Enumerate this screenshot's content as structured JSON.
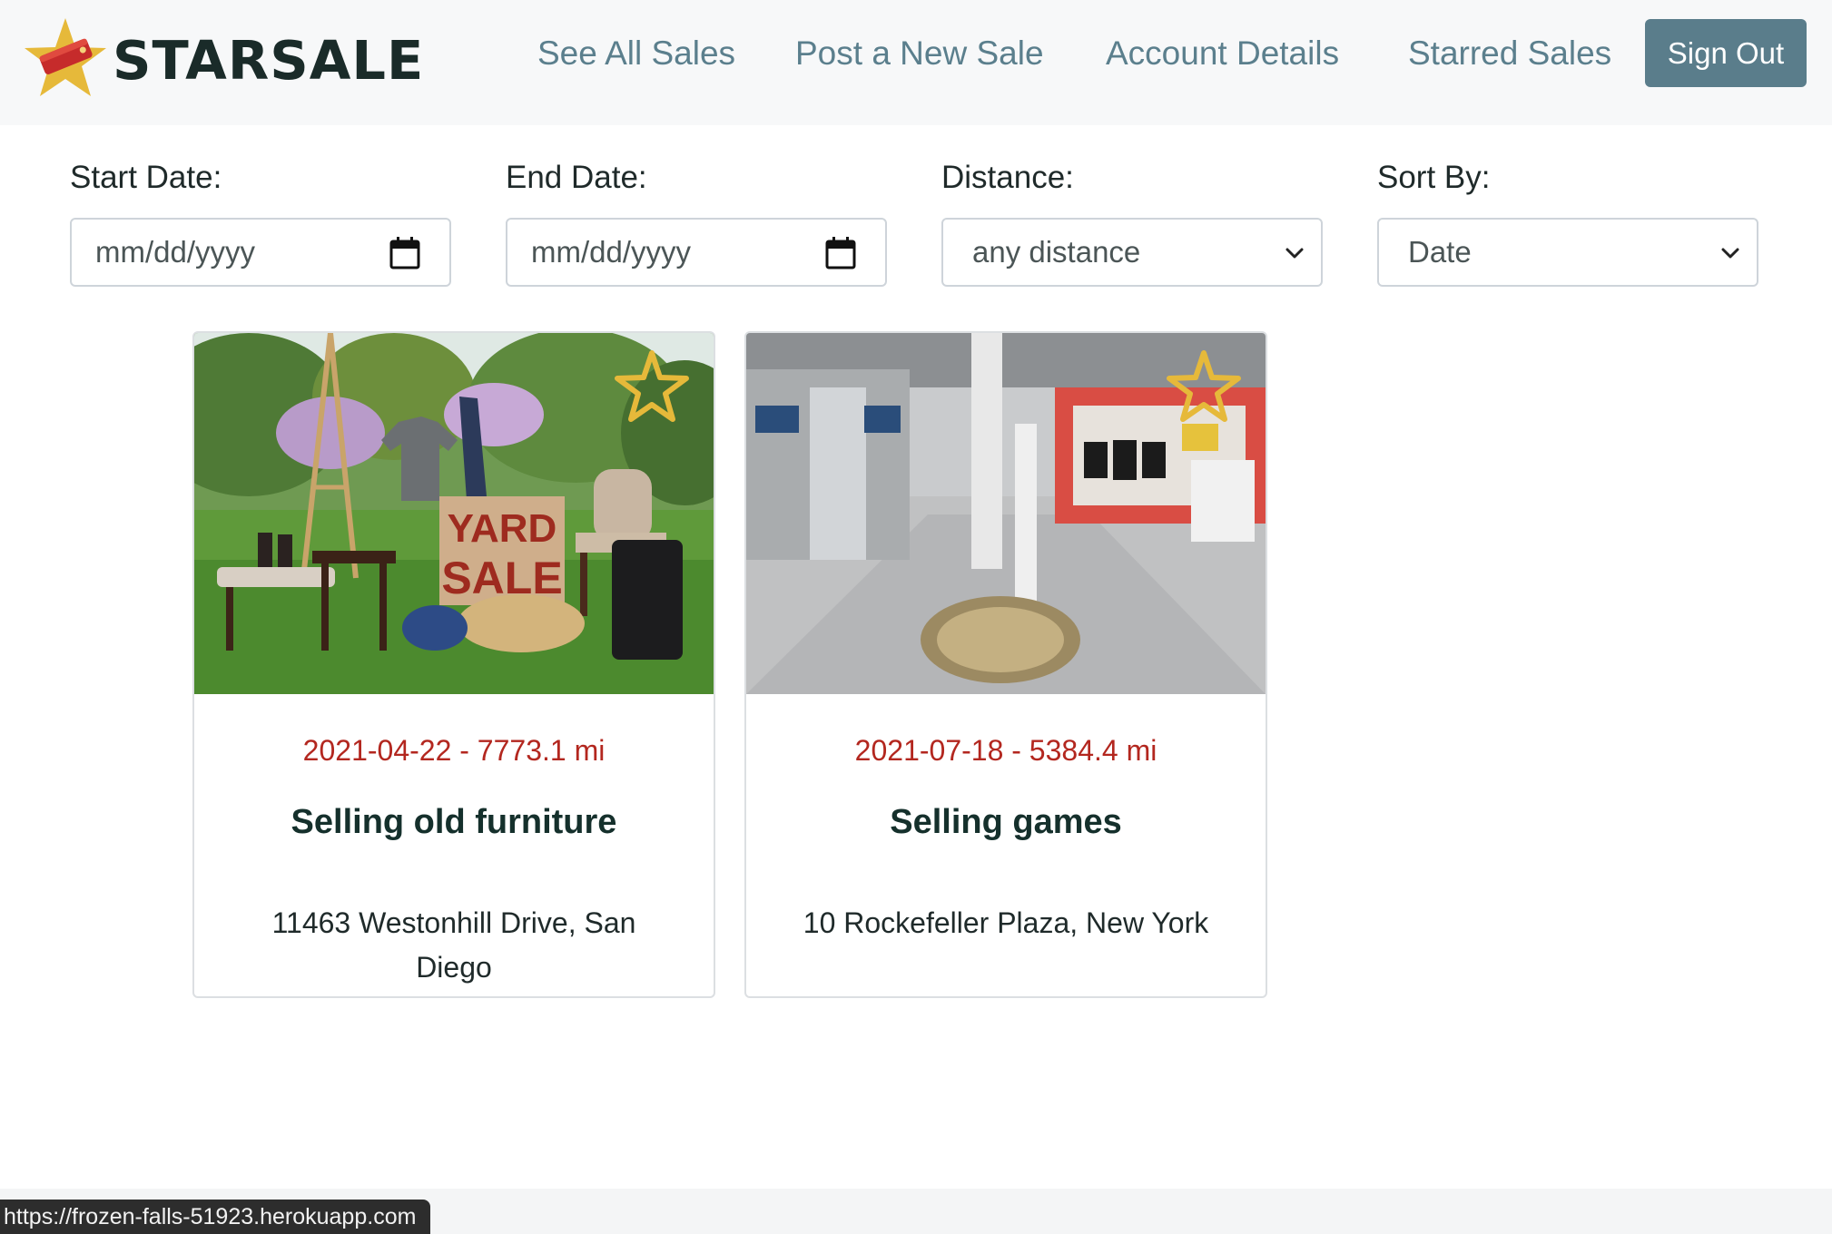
{
  "brand": {
    "name": "STARSALE",
    "logo_icon": "star-tag-logo-icon"
  },
  "nav": {
    "links": [
      "See All Sales",
      "Post a New Sale",
      "Account Details",
      "Starred Sales"
    ],
    "sign_out": "Sign Out"
  },
  "filters": {
    "start_date": {
      "label": "Start Date:",
      "placeholder": "mm/dd/yyyy",
      "icon": "calendar-icon"
    },
    "end_date": {
      "label": "End Date:",
      "placeholder": "mm/dd/yyyy",
      "icon": "calendar-icon"
    },
    "distance": {
      "label": "Distance:",
      "selected": "any distance",
      "icon": "chevron-down-icon"
    },
    "sort_by": {
      "label": "Sort By:",
      "selected": "Date",
      "icon": "chevron-down-icon"
    }
  },
  "sales": [
    {
      "meta": "2021-04-22 - 7773.1 mi",
      "title": "Selling old furniture",
      "address": "11463 Westonhill Drive, San Diego",
      "image_sign": [
        "YARD",
        "SALE"
      ],
      "starred": true
    },
    {
      "meta": "2021-07-18 - 5384.4 mi",
      "title": "Selling games",
      "address": "10 Rockefeller Plaza, New York",
      "image_sign": [],
      "starred": true
    }
  ],
  "status_bar": {
    "url": "https://frozen-falls-51923.herokuapp.com"
  },
  "colors": {
    "accent": "#5a7d8b",
    "nav_link": "#5b7f8d",
    "meta_red": "#b3271f",
    "star_gold": "#e6b93a",
    "brand_text": "#1a2b29"
  }
}
